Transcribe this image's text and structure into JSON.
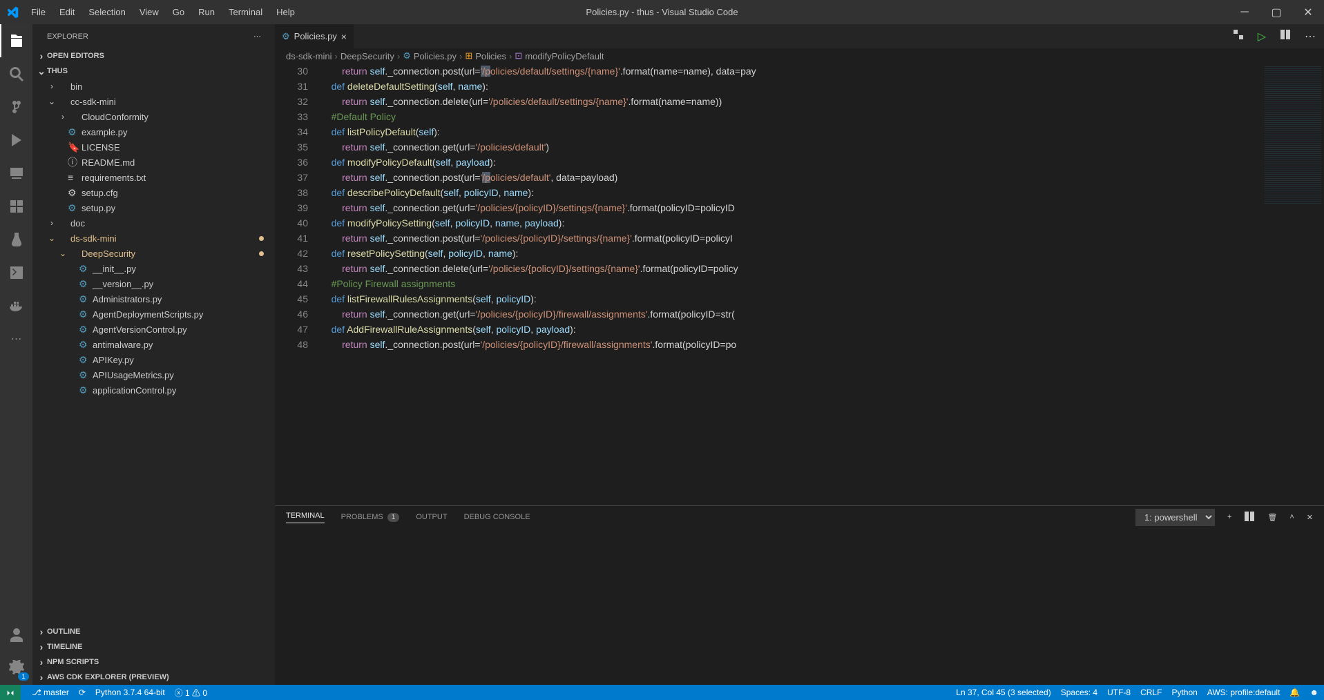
{
  "window": {
    "title": "Policies.py - thus - Visual Studio Code"
  },
  "menu": [
    "File",
    "Edit",
    "Selection",
    "View",
    "Go",
    "Run",
    "Terminal",
    "Help"
  ],
  "activitybar": {
    "settingsBadge": "1"
  },
  "sidebar": {
    "title": "EXPLORER",
    "sections": {
      "openEditors": "OPEN EDITORS",
      "workspace": "THUS",
      "outline": "OUTLINE",
      "timeline": "TIMELINE",
      "npm": "NPM SCRIPTS",
      "cdk": "AWS CDK EXPLORER (PREVIEW)"
    },
    "tree": [
      {
        "lvl": 1,
        "type": "folder",
        "collapsed": true,
        "label": "bin"
      },
      {
        "lvl": 1,
        "type": "folder",
        "collapsed": false,
        "label": "cc-sdk-mini"
      },
      {
        "lvl": 2,
        "type": "folder",
        "collapsed": true,
        "label": "CloudConformity"
      },
      {
        "lvl": 2,
        "type": "file",
        "icon": "py",
        "label": "example.py"
      },
      {
        "lvl": 2,
        "type": "file",
        "icon": "lic",
        "label": "LICENSE"
      },
      {
        "lvl": 2,
        "type": "file",
        "icon": "md",
        "label": "README.md"
      },
      {
        "lvl": 2,
        "type": "file",
        "icon": "txt",
        "label": "requirements.txt"
      },
      {
        "lvl": 2,
        "type": "file",
        "icon": "gear",
        "label": "setup.cfg"
      },
      {
        "lvl": 2,
        "type": "file",
        "icon": "py",
        "label": "setup.py"
      },
      {
        "lvl": 1,
        "type": "folder",
        "collapsed": true,
        "label": "doc"
      },
      {
        "lvl": 1,
        "type": "folder",
        "collapsed": false,
        "label": "ds-sdk-mini",
        "modified": true
      },
      {
        "lvl": 2,
        "type": "folder",
        "collapsed": false,
        "label": "DeepSecurity",
        "modified": true
      },
      {
        "lvl": 3,
        "type": "file",
        "icon": "py",
        "label": "__init__.py"
      },
      {
        "lvl": 3,
        "type": "file",
        "icon": "py",
        "label": "__version__.py"
      },
      {
        "lvl": 3,
        "type": "file",
        "icon": "py",
        "label": "Administrators.py"
      },
      {
        "lvl": 3,
        "type": "file",
        "icon": "py",
        "label": "AgentDeploymentScripts.py"
      },
      {
        "lvl": 3,
        "type": "file",
        "icon": "py",
        "label": "AgentVersionControl.py"
      },
      {
        "lvl": 3,
        "type": "file",
        "icon": "py",
        "label": "antimalware.py"
      },
      {
        "lvl": 3,
        "type": "file",
        "icon": "py",
        "label": "APIKey.py"
      },
      {
        "lvl": 3,
        "type": "file",
        "icon": "py",
        "label": "APIUsageMetrics.py"
      },
      {
        "lvl": 3,
        "type": "file",
        "icon": "py",
        "label": "applicationControl.py"
      }
    ]
  },
  "tab": {
    "filename": "Policies.py"
  },
  "breadcrumb": [
    "ds-sdk-mini",
    "DeepSecurity",
    "Policies.py",
    "Policies",
    "modifyPolicyDefault"
  ],
  "code": {
    "startLine": 30,
    "lines": [
      {
        "n": 30,
        "html": "        <span class='kw2'>return</span> <span class='self'>self</span>._connection.post(url=<span class='str'><span class='hl'>'/p</span>olicies/default/settings/{name}'</span>.format(name=name), data=pay"
      },
      {
        "n": 31,
        "html": "    <span class='kw'>def</span> <span class='fn'>deleteDefaultSetting</span>(<span class='var'>self</span>, <span class='var'>name</span>):"
      },
      {
        "n": 32,
        "html": "        <span class='kw2'>return</span> <span class='self'>self</span>._connection.delete(url=<span class='str'>'/policies/default/settings/{name}'</span>.format(name=name))"
      },
      {
        "n": 33,
        "html": "    <span class='cmt'>#Default Policy</span>"
      },
      {
        "n": 34,
        "html": "    <span class='kw'>def</span> <span class='fn'>listPolicyDefault</span>(<span class='var'>self</span>):"
      },
      {
        "n": 35,
        "html": "        <span class='kw2'>return</span> <span class='self'>self</span>._connection.get(url=<span class='str'>'/policies/default'</span>)"
      },
      {
        "n": 36,
        "html": "    <span class='kw'>def</span> <span class='fn'>modifyPolicyDefault</span>(<span class='var'>self</span>, <span class='var'>payload</span>):"
      },
      {
        "n": 37,
        "html": "        <span class='kw2'>return</span> <span class='self'>self</span>._connection.post(url=<span class='str'>'<span class='hl'>/p</span>olicies/default'</span>, data=payload)"
      },
      {
        "n": 38,
        "html": "    <span class='kw'>def</span> <span class='fn'>describePolicyDefault</span>(<span class='var'>self</span>, <span class='var'>policyID</span>, <span class='var'>name</span>):"
      },
      {
        "n": 39,
        "html": "        <span class='kw2'>return</span> <span class='self'>self</span>._connection.get(url=<span class='str'>'/policies/{policyID}/settings/{name}'</span>.format(policyID=policyID"
      },
      {
        "n": 40,
        "html": "    <span class='kw'>def</span> <span class='fn'>modifyPolicySetting</span>(<span class='var'>self</span>, <span class='var'>policyID</span>, <span class='var'>name</span>, <span class='var'>payload</span>):"
      },
      {
        "n": 41,
        "html": "        <span class='kw2'>return</span> <span class='self'>self</span>._connection.post(url=<span class='str'>'/policies/{policyID}/settings/{name}'</span>.format(policyID=policyI"
      },
      {
        "n": 42,
        "html": "    <span class='kw'>def</span> <span class='fn'>resetPolicySetting</span>(<span class='var'>self</span>, <span class='var'>policyID</span>, <span class='var'>name</span>):"
      },
      {
        "n": 43,
        "html": "        <span class='kw2'>return</span> <span class='self'>self</span>._connection.delete(url=<span class='str'>'/policies/{policyID}/settings/{name}'</span>.format(policyID=policy"
      },
      {
        "n": 44,
        "html": "    <span class='cmt'>#Policy Firewall assignments</span>"
      },
      {
        "n": 45,
        "html": "    <span class='kw'>def</span> <span class='fn'>listFirewallRulesAssignments</span>(<span class='var'>self</span>, <span class='var'>policyID</span>):"
      },
      {
        "n": 46,
        "html": "        <span class='kw2'>return</span> <span class='self'>self</span>._connection.get(url=<span class='str'>'/policies/{policyID}/firewall/assignments'</span>.format(policyID=str("
      },
      {
        "n": 47,
        "html": "    <span class='kw'>def</span> <span class='fn'>AddFirewallRuleAssignments</span>(<span class='var'>self</span>, <span class='var'>policyID</span>, <span class='var'>payload</span>):"
      },
      {
        "n": 48,
        "html": "        <span class='kw2'>return</span> <span class='self'>self</span>._connection.post(url=<span class='str'>'/policies/{policyID}/firewall/assignments'</span>.format(policyID=po"
      }
    ]
  },
  "panel": {
    "tabs": {
      "terminal": "TERMINAL",
      "problems": "PROBLEMS",
      "problemsCount": "1",
      "output": "OUTPUT",
      "debug": "DEBUG CONSOLE"
    },
    "shell": "1: powershell"
  },
  "status": {
    "branch": "master",
    "python": "Python 3.7.4 64-bit",
    "errors": "1",
    "warnings": "0",
    "cursor": "Ln 37, Col 45 (3 selected)",
    "spaces": "Spaces: 4",
    "encoding": "UTF-8",
    "eol": "CRLF",
    "lang": "Python",
    "aws": "AWS: profile:default"
  }
}
